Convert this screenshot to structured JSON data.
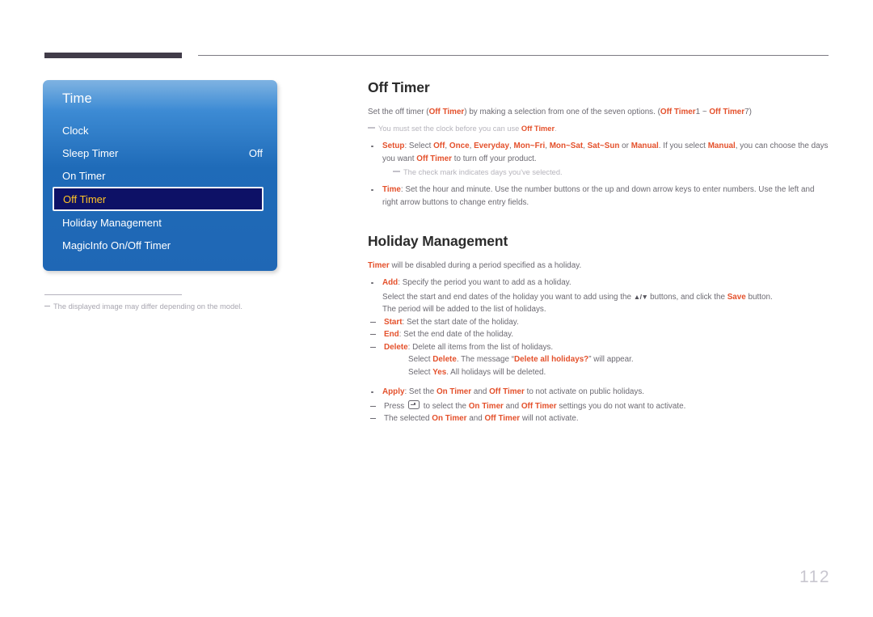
{
  "header": {
    "rule_accent_color": "#413c49",
    "rule_line_color": "#7d7a84"
  },
  "osd": {
    "title": "Time",
    "items": [
      {
        "label": "Clock",
        "value": "",
        "selected": false
      },
      {
        "label": "Sleep Timer",
        "value": "Off",
        "selected": false
      },
      {
        "label": "On Timer",
        "value": "",
        "selected": false
      },
      {
        "label": "Off Timer",
        "value": "",
        "selected": true
      },
      {
        "label": "Holiday Management",
        "value": "",
        "selected": false
      },
      {
        "label": "MagicInfo On/Off Timer",
        "value": "",
        "selected": false
      }
    ],
    "selected_bg": "#0d1166",
    "selected_text": "#ffc425",
    "panel_blue": "#1f67b5"
  },
  "caption": {
    "text": "The displayed image may differ depending on the model."
  },
  "sections": {
    "off_timer": {
      "heading": "Off Timer",
      "lead_1": "Set the off timer (",
      "lead_key_1": "Off Timer",
      "lead_2": ") by making a selection from one of the seven options. (",
      "lead_key_2": "Off Timer",
      "lead_3": "1 ~ ",
      "lead_key_3": "Off Timer",
      "lead_4": "7)",
      "note": "You must set the clock before you can use ",
      "note_key": "Off Timer",
      "note_end": ".",
      "setup": {
        "term": "Setup",
        "t1": ": Select ",
        "opt1": "Off",
        "s1": ", ",
        "opt2": "Once",
        "s2": ", ",
        "opt3": "Everyday",
        "s3": ", ",
        "opt4": "Mon~Fri",
        "s4": ", ",
        "opt5": "Mon~Sat",
        "s5": ", ",
        "opt6": "Sat~Sun",
        "s6": " or ",
        "opt7": "Manual",
        "t2": ". If you select ",
        "opt8": "Manual",
        "t3": ", you can choose the days you want ",
        "opt9": "Off Timer",
        "t4": " to turn off your product."
      },
      "setup_note": "The check mark indicates days you've selected.",
      "time": {
        "term": "Time",
        "text": ": Set the hour and minute. Use the number buttons or the up and down arrow keys to enter numbers. Use the left and right arrow buttons to change entry fields."
      }
    },
    "holiday": {
      "heading": "Holiday Management",
      "lead_key": "Timer",
      "lead_text": " will be disabled during a period specified as a holiday.",
      "add": {
        "term": "Add",
        "text": ": Specify the period you want to add as a holiday.",
        "line2_a": "Select the start and end dates of the holiday you want to add using the ",
        "line2_arrows": "▲/▼",
        "line2_b": " buttons, and click the ",
        "line2_key": "Save",
        "line2_c": " button.",
        "line3": "The period will be added to the list of holidays."
      },
      "start": {
        "term": "Start",
        "text": ": Set the start date of the holiday."
      },
      "end": {
        "term": "End",
        "text": ": Set the end date of the holiday."
      },
      "delete": {
        "term": "Delete",
        "text": ": Delete all items from the list of holidays.",
        "line2_a": "Select ",
        "line2_key": "Delete",
        "line2_b": ". The message “",
        "line2_msg": "Delete all holidays?",
        "line2_c": "” will appear.",
        "line3_a": "Select ",
        "line3_key": "Yes",
        "line3_b": ". All holidays will be deleted."
      },
      "apply": {
        "term": "Apply",
        "t1": ": Set the ",
        "k1": "On Timer",
        "t2": " and ",
        "k2": "Off Timer",
        "t3": " to not activate on public holidays.",
        "sub1_a": "Press ",
        "sub1_icon": "enter-key-icon",
        "sub1_b": " to select the ",
        "sub1_k1": "On Timer",
        "sub1_c": " and ",
        "sub1_k2": "Off Timer",
        "sub1_d": " settings you do not want to activate.",
        "sub2_a": "The selected ",
        "sub2_k1": "On Timer",
        "sub2_b": " and ",
        "sub2_k2": "Off Timer",
        "sub2_c": " will not activate."
      }
    }
  },
  "page_number": "112"
}
